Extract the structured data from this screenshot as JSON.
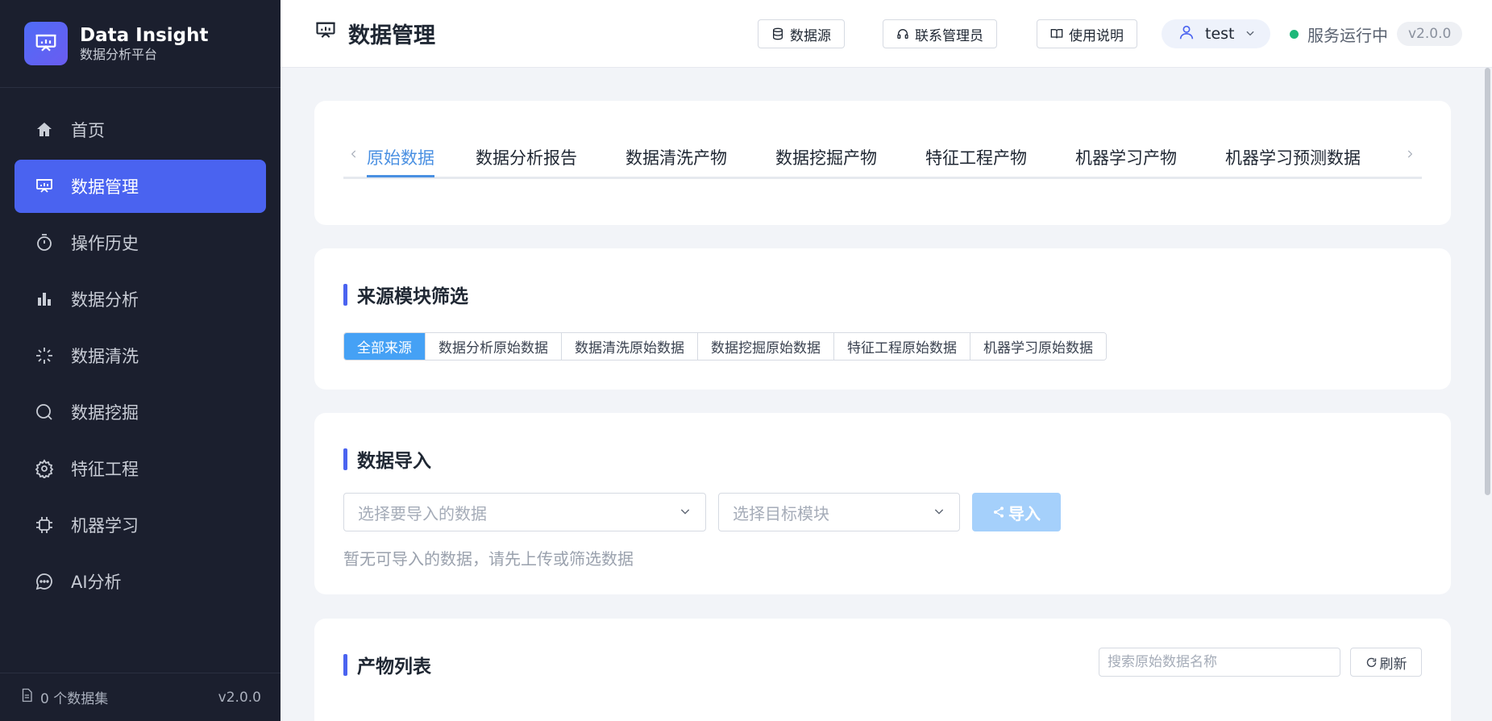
{
  "brand": {
    "title": "Data Insight",
    "subtitle": "数据分析平台"
  },
  "sidebar": {
    "items": [
      {
        "label": "首页",
        "icon": "home-icon"
      },
      {
        "label": "数据管理",
        "icon": "presentation-icon",
        "active": true
      },
      {
        "label": "操作历史",
        "icon": "timer-icon"
      },
      {
        "label": "数据分析",
        "icon": "bar-chart-icon"
      },
      {
        "label": "数据清洗",
        "icon": "sparkle-icon"
      },
      {
        "label": "数据挖掘",
        "icon": "search-icon"
      },
      {
        "label": "特征工程",
        "icon": "gear-icon"
      },
      {
        "label": "机器学习",
        "icon": "chip-icon"
      },
      {
        "label": "AI分析",
        "icon": "chat-icon"
      }
    ],
    "footer": {
      "datasets": "0 个数据集",
      "version": "v2.0.0"
    }
  },
  "header": {
    "title": "数据管理",
    "buttons": {
      "datasource": "数据源",
      "contact": "联系管理员",
      "guide": "使用说明"
    },
    "user": "test",
    "status": "服务运行中",
    "version": "v2.0.0"
  },
  "tabs": {
    "items": [
      "原始数据",
      "数据分析报告",
      "数据清洗产物",
      "数据挖掘产物",
      "特征工程产物",
      "机器学习产物",
      "机器学习预测数据"
    ],
    "active_index": 0
  },
  "filter": {
    "title": "来源模块筛选",
    "options": [
      "全部来源",
      "数据分析原始数据",
      "数据清洗原始数据",
      "数据挖掘原始数据",
      "特征工程原始数据",
      "机器学习原始数据"
    ],
    "active_index": 0
  },
  "import": {
    "title": "数据导入",
    "data_select_placeholder": "选择要导入的数据",
    "module_select_placeholder": "选择目标模块",
    "button": "导入",
    "hint": "暂无可导入的数据，请先上传或筛选数据"
  },
  "products": {
    "title": "产物列表",
    "search_placeholder": "搜索原始数据名称",
    "refresh": "刷新"
  },
  "colors": {
    "accent": "#4a63f0",
    "sidebar_bg": "#1b1f2e",
    "tab_active": "#4a90e2",
    "status_ok": "#1fb87a"
  }
}
